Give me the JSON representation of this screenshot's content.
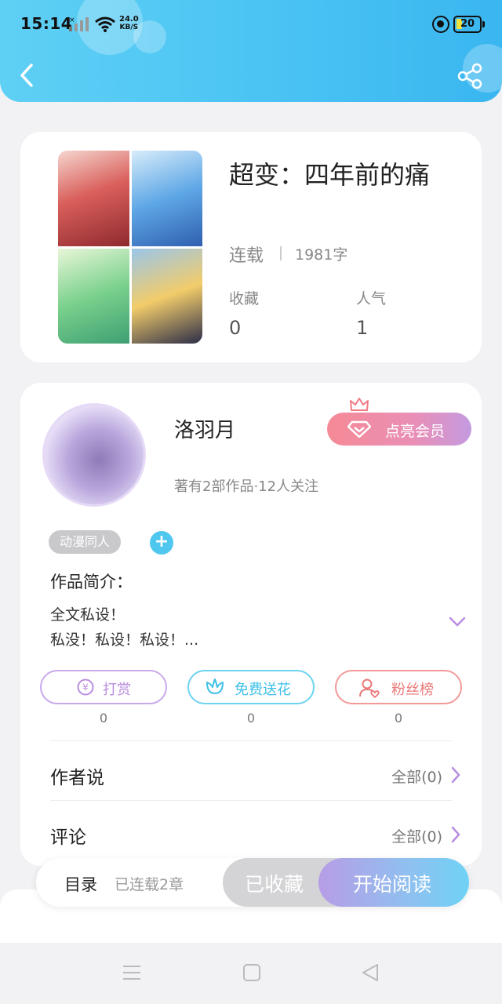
{
  "status_bar": {
    "time": "15:14",
    "net_speed_value": "24.0",
    "net_speed_unit": "KB/S",
    "battery": "20"
  },
  "header": {
    "back_icon": "chevron-left-icon",
    "share_icon": "share-icon",
    "background_color": "#48c2f3"
  },
  "book": {
    "title": "超变：四年前的痛",
    "status": "连载",
    "word_count": "1981字",
    "stats": [
      {
        "label": "收藏",
        "value": "0"
      },
      {
        "label": "人气",
        "value": "1"
      }
    ]
  },
  "author": {
    "name": "洛羽月",
    "meta": "著有2部作品·12人关注",
    "vip_label": "点亮会员",
    "tag": "动漫同人",
    "add_tag_symbol": "+",
    "intro_title": "作品简介：",
    "intro_lines": [
      "全文私设！",
      "私没！私设！私设！..."
    ]
  },
  "actions": [
    {
      "label": "打赏",
      "count": "0",
      "icon": "yen-coin-icon",
      "color": "#b98de0"
    },
    {
      "label": "免费送花",
      "count": "0",
      "icon": "flower-icon",
      "color": "#3fc0e6"
    },
    {
      "label": "粉丝榜",
      "count": "0",
      "icon": "fan-user-icon",
      "color": "#ea7a7a"
    }
  ],
  "sections": [
    {
      "title": "作者说",
      "right": "全部(0)"
    },
    {
      "title": "评论",
      "right": "全部(0)"
    }
  ],
  "bottom_bar": {
    "toc": "目录",
    "chapters": "已连载2章",
    "favorite": "已收藏",
    "read": "开始阅读"
  }
}
